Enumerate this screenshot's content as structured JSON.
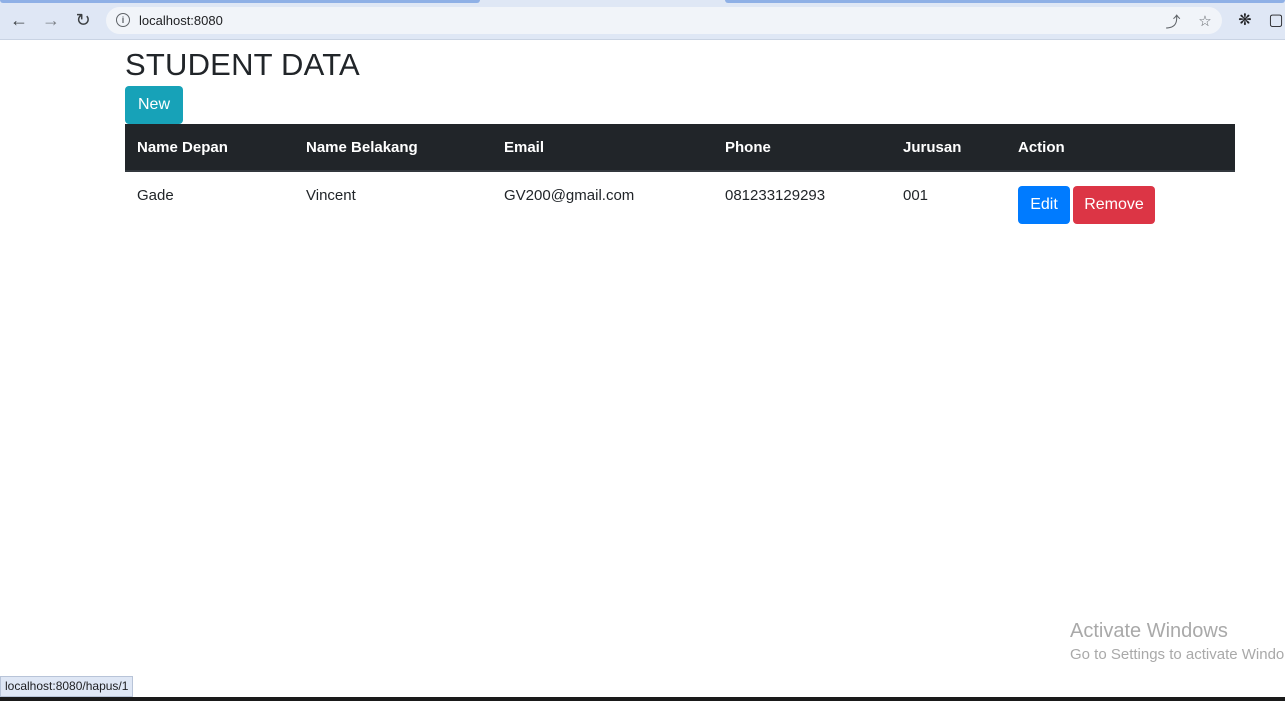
{
  "browser": {
    "url": "localhost:8080",
    "status_url": "localhost:8080/hapus/1"
  },
  "page": {
    "title": "STUDENT DATA",
    "new_button": "New"
  },
  "table": {
    "headers": [
      "Name Depan",
      "Name Belakang",
      "Email",
      "Phone",
      "Jurusan",
      "Action"
    ],
    "rows": [
      {
        "first_name": "Gade",
        "last_name": "Vincent",
        "email": "GV200@gmail.com",
        "phone": "081233129293",
        "jurusan": "001",
        "edit_label": "Edit",
        "remove_label": "Remove"
      }
    ]
  },
  "watermark": {
    "line1": "Activate Windows",
    "line2": "Go to Settings to activate Windo"
  },
  "colors": {
    "new_button": "#17a2b8",
    "edit_button": "#007bff",
    "remove_button": "#dc3545",
    "table_header": "#212529"
  }
}
